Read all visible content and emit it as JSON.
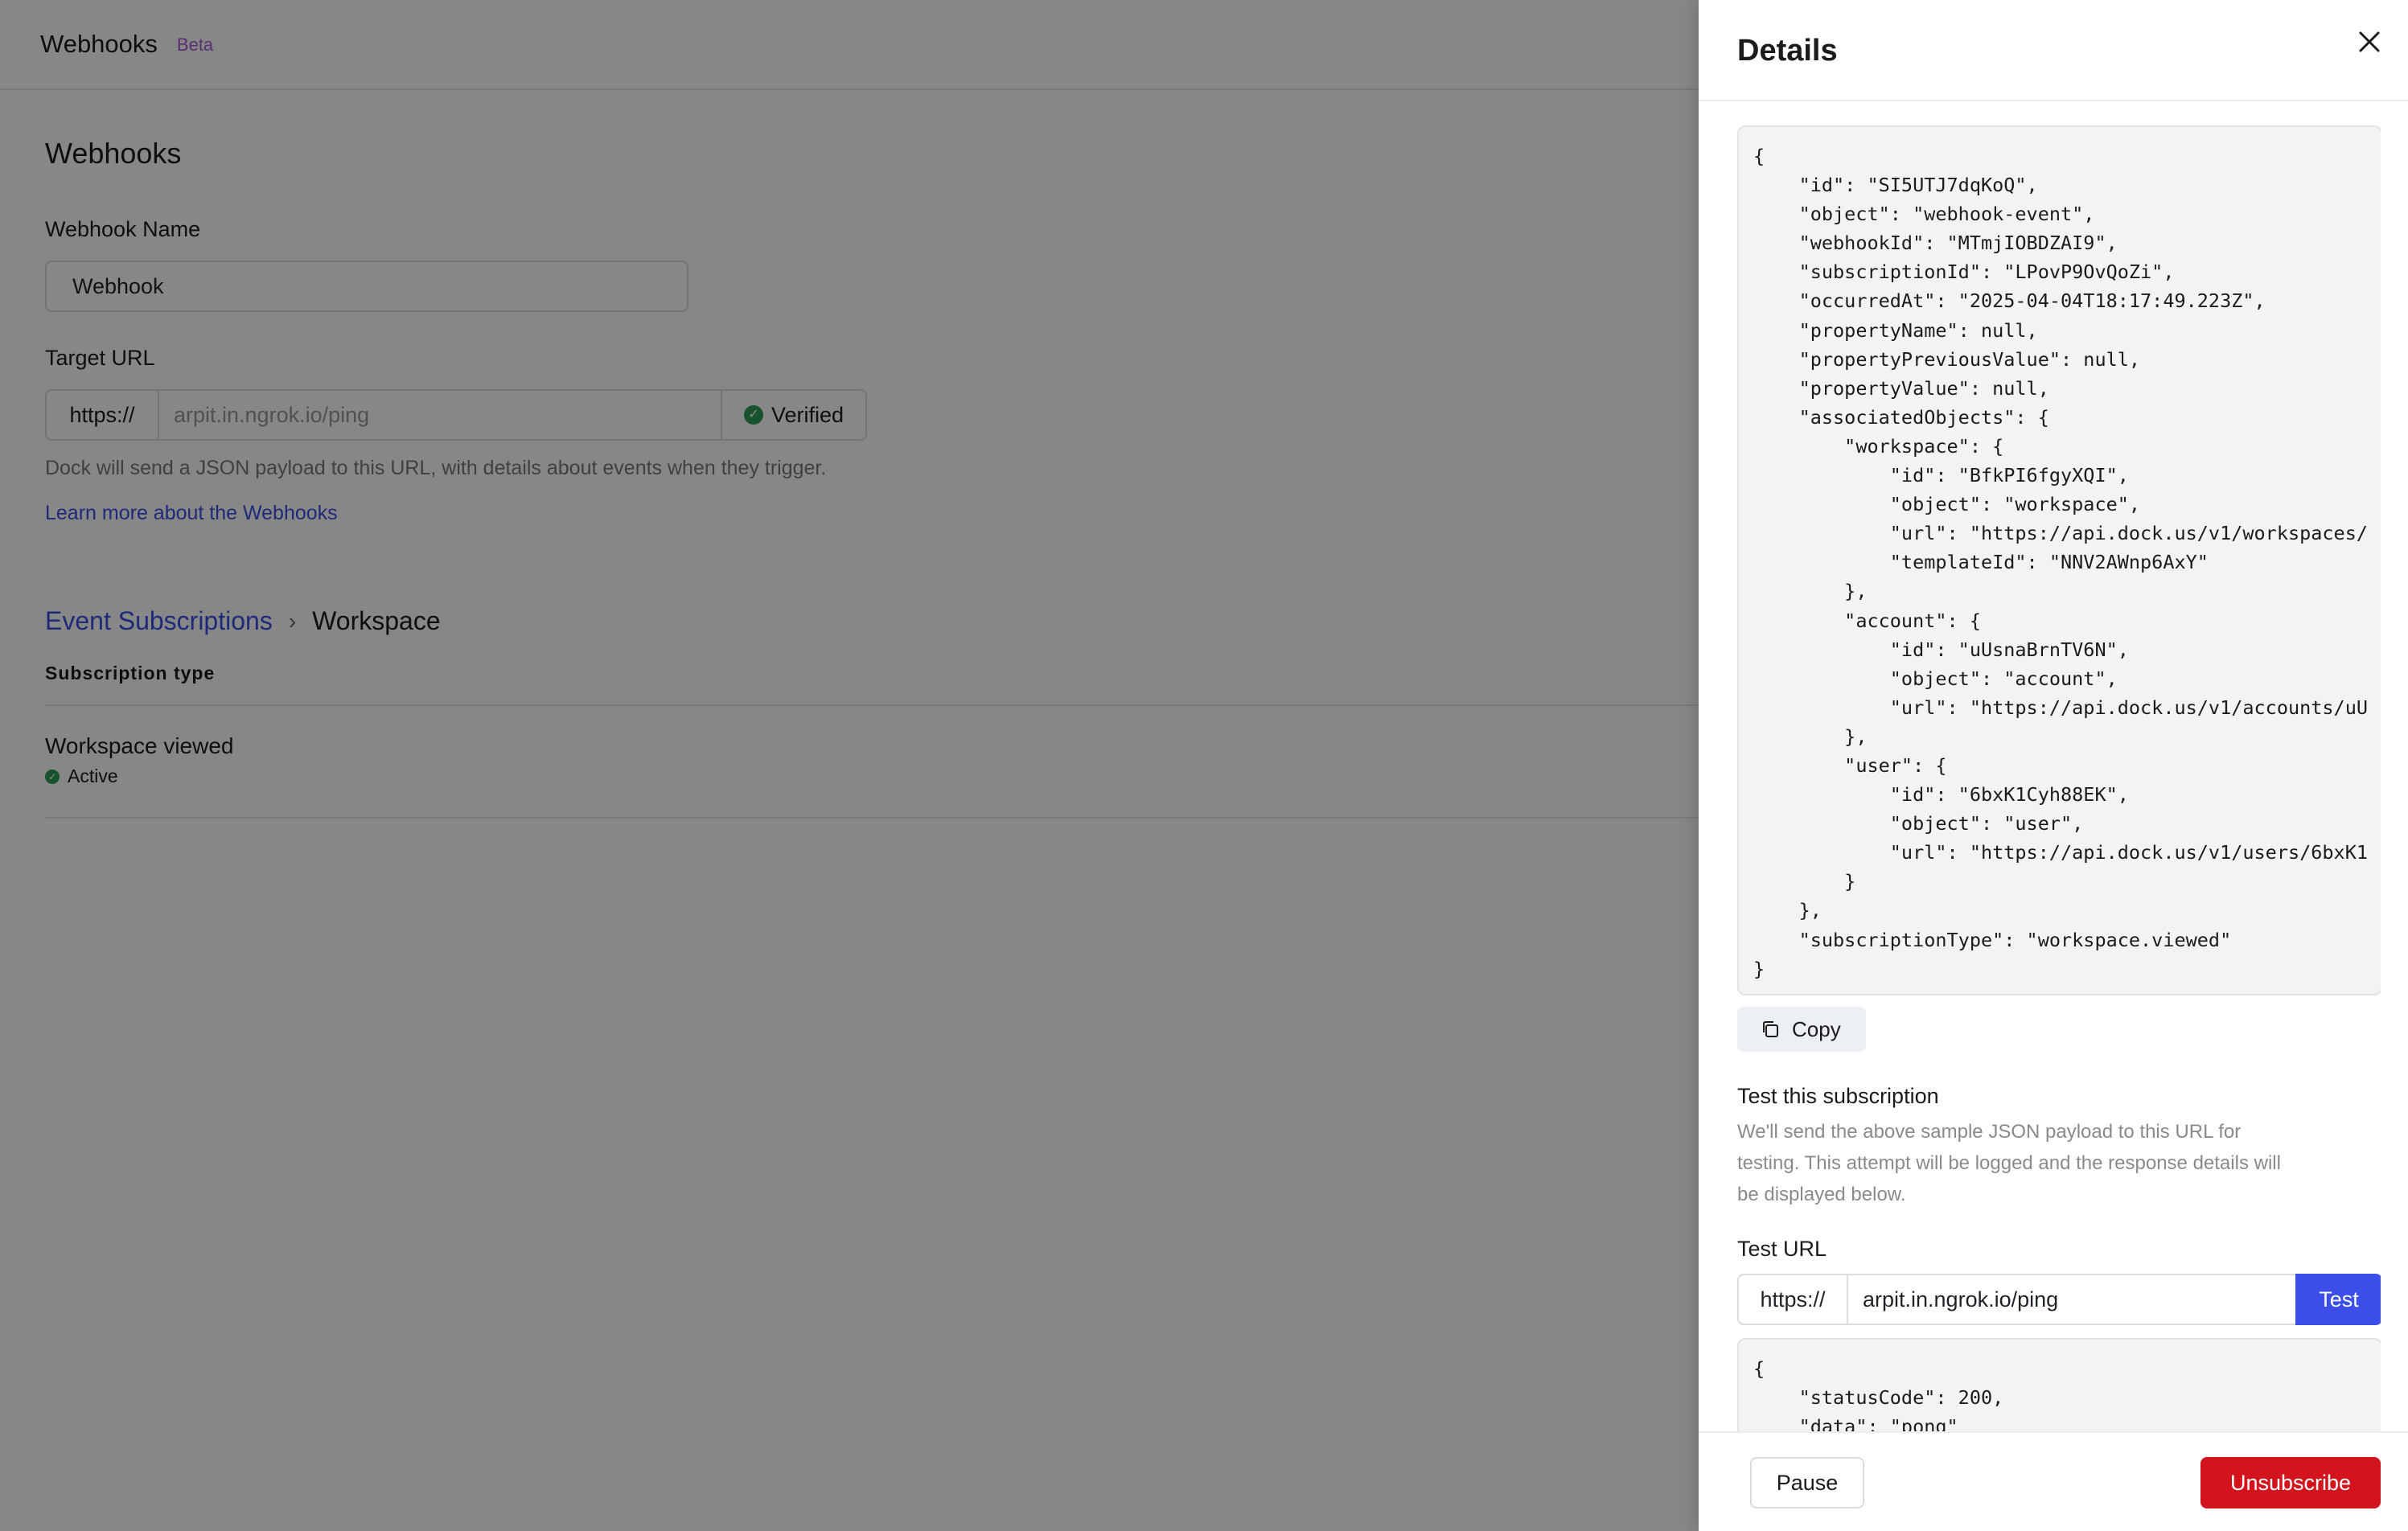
{
  "header": {
    "title": "Webhooks",
    "badge": "Beta"
  },
  "main": {
    "heading": "Webhooks",
    "webhook_name_label": "Webhook Name",
    "webhook_name_value": "Webhook",
    "target_url_label": "Target URL",
    "target_url_prefix": "https://",
    "target_url_value": "arpit.in.ngrok.io/ping",
    "verified_label": "Verified",
    "helper_text": "Dock will send a JSON payload to this URL, with details about events when they trigger.",
    "learn_more_link": "Learn more about the Webhooks",
    "breadcrumb": {
      "parent": "Event Subscriptions",
      "current": "Workspace"
    },
    "subscription_type_label": "Subscription type",
    "subscription": {
      "title": "Workspace viewed",
      "status": "Active"
    }
  },
  "drawer": {
    "title": "Details",
    "payload_json": "{\n    \"id\": \"SI5UTJ7dqKoQ\",\n    \"object\": \"webhook-event\",\n    \"webhookId\": \"MTmjIOBDZAI9\",\n    \"subscriptionId\": \"LPovP9OvQoZi\",\n    \"occurredAt\": \"2025-04-04T18:17:49.223Z\",\n    \"propertyName\": null,\n    \"propertyPreviousValue\": null,\n    \"propertyValue\": null,\n    \"associatedObjects\": {\n        \"workspace\": {\n            \"id\": \"BfkPI6fgyXQI\",\n            \"object\": \"workspace\",\n            \"url\": \"https://api.dock.us/v1/workspaces/\n            \"templateId\": \"NNV2AWnp6AxY\"\n        },\n        \"account\": {\n            \"id\": \"uUsnaBrnTV6N\",\n            \"object\": \"account\",\n            \"url\": \"https://api.dock.us/v1/accounts/uU\n        },\n        \"user\": {\n            \"id\": \"6bxK1Cyh88EK\",\n            \"object\": \"user\",\n            \"url\": \"https://api.dock.us/v1/users/6bxK1\n        }\n    },\n    \"subscriptionType\": \"workspace.viewed\"\n}",
    "copy_label": "Copy",
    "test_title": "Test this subscription",
    "test_description": "We'll send the above sample JSON payload to this URL for testing. This attempt will be logged and the response details will be displayed below.",
    "test_url_label": "Test URL",
    "test_url_prefix": "https://",
    "test_url_value": "arpit.in.ngrok.io/ping",
    "test_button": "Test",
    "response_json": "{\n    \"statusCode\": 200,\n    \"data\": \"pong\"\n}",
    "pause_button": "Pause",
    "unsubscribe_button": "Unsubscribe"
  },
  "colors": {
    "accent": "#3b4fe8",
    "danger": "#d4141c",
    "success": "#2f9e55",
    "beta": "#a35bd6",
    "link": "#3b4fe0"
  }
}
